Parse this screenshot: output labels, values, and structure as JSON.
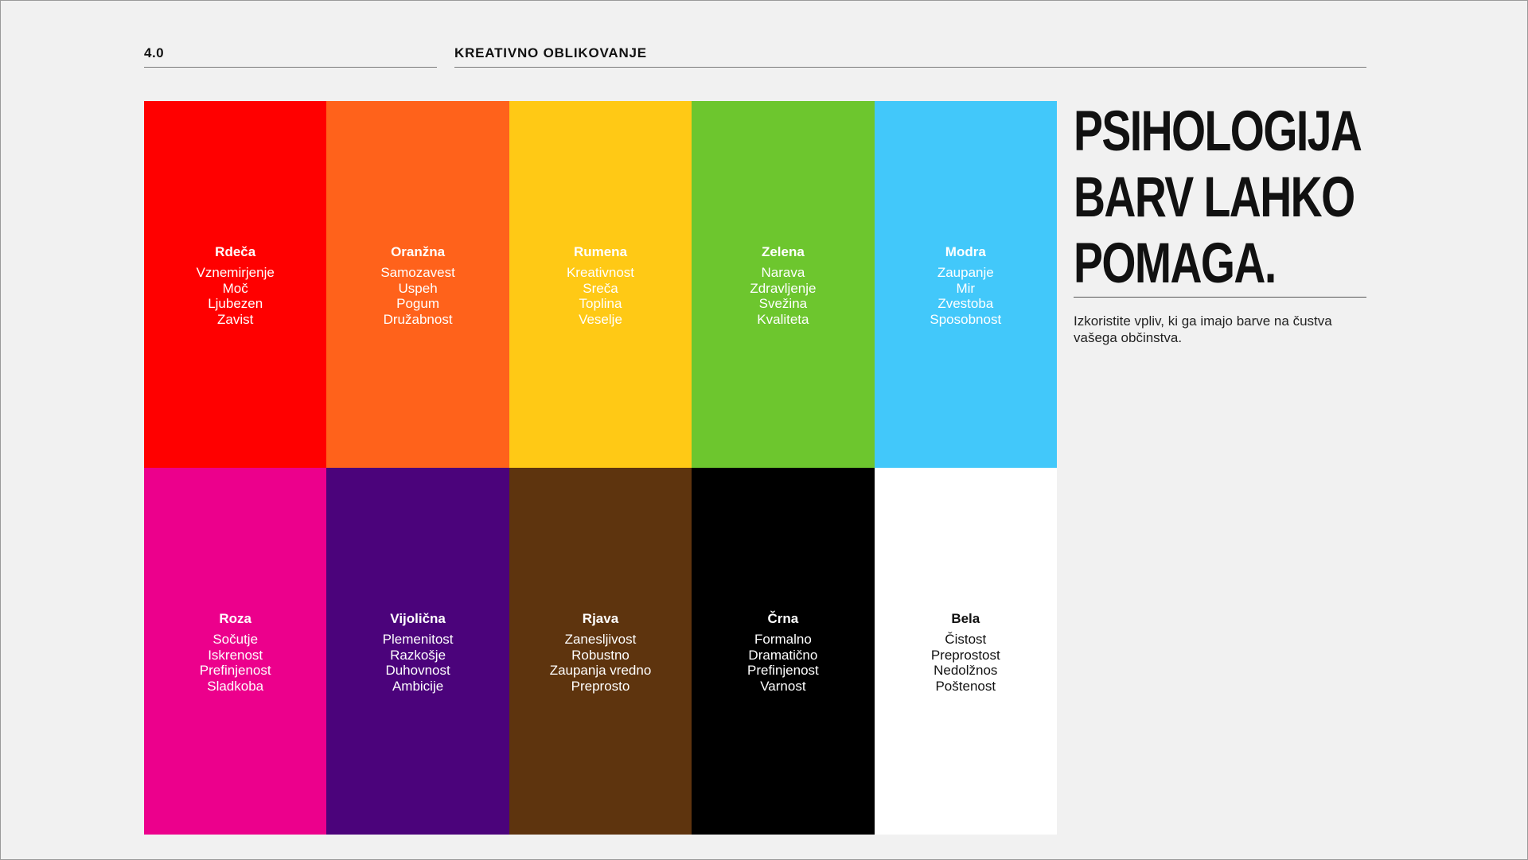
{
  "header": {
    "section_number": "4.0",
    "section_title": "KREATIVNO OBLIKOVANJE"
  },
  "colors": [
    {
      "name": "Rdeča",
      "bg": "#ff0000",
      "text": "#ffffff",
      "words": [
        "Vznemirjenje",
        "Moč",
        "Ljubezen",
        "Zavist"
      ]
    },
    {
      "name": "Oranžna",
      "bg": "#ff621b",
      "text": "#ffffff",
      "words": [
        "Samozavest",
        "Uspeh",
        "Pogum",
        "Družabnost"
      ]
    },
    {
      "name": "Rumena",
      "bg": "#ffc915",
      "text": "#ffffff",
      "words": [
        "Kreativnost",
        "Sreča",
        "Toplina",
        "Veselje"
      ]
    },
    {
      "name": "Zelena",
      "bg": "#6dc62e",
      "text": "#ffffff",
      "words": [
        "Narava",
        "Zdravljenje",
        "Svežina",
        "Kvaliteta"
      ]
    },
    {
      "name": "Modra",
      "bg": "#42c8fa",
      "text": "#ffffff",
      "words": [
        "Zaupanje",
        "Mir",
        "Zvestoba",
        "Sposobnost"
      ]
    },
    {
      "name": "Roza",
      "bg": "#ec008c",
      "text": "#ffffff",
      "words": [
        "Sočutje",
        "Iskrenost",
        "Prefinjenost",
        "Sladkoba"
      ]
    },
    {
      "name": "Vijolična",
      "bg": "#4b037b",
      "text": "#ffffff",
      "words": [
        "Plemenitost",
        "Razkošje",
        "Duhovnost",
        "Ambicije"
      ]
    },
    {
      "name": "Rjava",
      "bg": "#5e340e",
      "text": "#ffffff",
      "words": [
        "Zanesljivost",
        "Robustno",
        "Zaupanja vredno",
        "Preprosto"
      ]
    },
    {
      "name": "Črna",
      "bg": "#000000",
      "text": "#ffffff",
      "words": [
        "Formalno",
        "Dramatično",
        "Prefinjenost",
        "Varnost"
      ]
    },
    {
      "name": "Bela",
      "bg": "#ffffff",
      "text": "#111111",
      "words": [
        "Čistost",
        "Preprostost",
        "Nedolžnos",
        "Poštenost"
      ]
    }
  ],
  "headline": {
    "lines": [
      "PSIHOLOGIJA",
      "BARV LAHKO",
      "POMAGA."
    ]
  },
  "subtext": "Izkoristite vpliv, ki ga imajo barve na čustva vašega občinstva."
}
